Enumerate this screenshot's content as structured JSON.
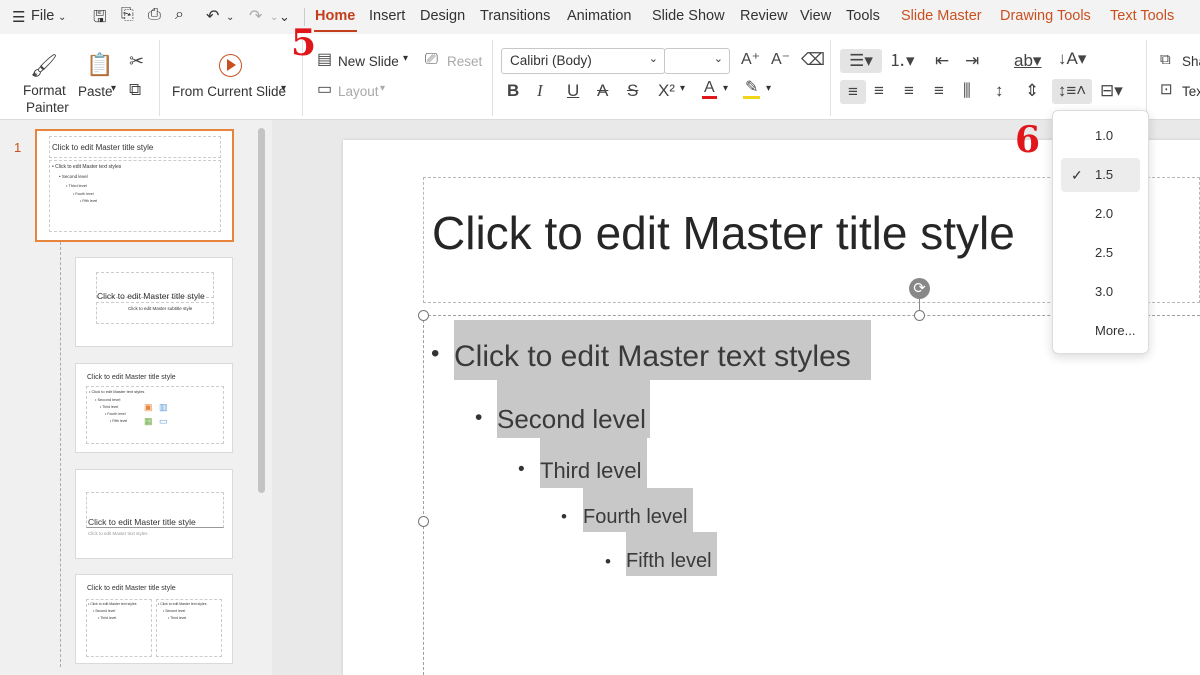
{
  "menubar": {
    "file_label": "File",
    "tabs": [
      "Home",
      "Insert",
      "Design",
      "Transitions",
      "Animation",
      "Slide Show",
      "Review",
      "View",
      "Tools"
    ],
    "context_tabs": [
      "Slide Master",
      "Drawing Tools",
      "Text Tools"
    ]
  },
  "ribbon": {
    "format_painter": [
      "Format",
      "Painter"
    ],
    "paste": "Paste",
    "from_current_slide": "From Current Slide",
    "new_slide": "New Slide",
    "reset": "Reset",
    "layout": "Layout",
    "font_name": "Calibri (Body)",
    "font_size": "",
    "right_cut": [
      "Sha",
      "Tex"
    ]
  },
  "thumbnails": [
    {
      "number": "1",
      "title": "Click to edit Master title style",
      "lines": [
        "• Click to edit Master text styles",
        "• Second level",
        "• Third level",
        "• Fourth level",
        "• Fifth level"
      ]
    },
    {
      "title": "Click to edit Master title style",
      "sub": "Click to edit Master subtitle style"
    },
    {
      "title": "Click to edit Master title style",
      "lines": [
        "• Click to edit Master text styles",
        "• Second level",
        "• Third level",
        "• Fourth level",
        "• Fifth level"
      ]
    },
    {
      "title": "Click to edit Master title style",
      "sub": "Click to edit Master text styles"
    },
    {
      "title": "Click to edit Master title style",
      "lines": [
        "• Click to edit Master text styles",
        "• Second level",
        "• Third level"
      ]
    }
  ],
  "slide": {
    "title": "Click to edit Master title style",
    "levels": [
      "Click to edit Master text styles",
      "Second level",
      "Third level",
      "Fourth level",
      "Fifth level"
    ]
  },
  "line_spacing_menu": {
    "options": [
      "1.0",
      "1.5",
      "2.0",
      "2.5",
      "3.0",
      "More..."
    ],
    "selected": "1.5"
  },
  "annotations": {
    "step5": "5",
    "step6": "6"
  },
  "colors": {
    "accent": "#c43e1c",
    "annotation": "#e0161b",
    "thumb_active": "#e8853d"
  }
}
